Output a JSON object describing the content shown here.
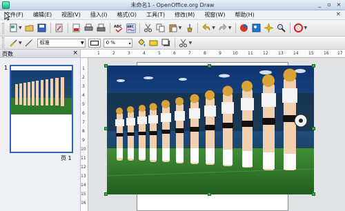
{
  "window": {
    "title": "未命名1 - OpenOffice.org Draw",
    "buttons": [
      "_",
      "▫",
      "×"
    ]
  },
  "menu": {
    "items": [
      "文件(F)",
      "编辑(E)",
      "视图(V)",
      "插入(I)",
      "格式(O)",
      "工具(T)",
      "修改(M)",
      "视窗(W)",
      "帮助(H)"
    ],
    "close": "×"
  },
  "toolbar2": {
    "style_value": "标准",
    "zoom_value": "0 %"
  },
  "panel": {
    "title": "页数",
    "close": "×",
    "slide_number": "1",
    "page_indicator": "页 1"
  },
  "ruler": {
    "top_numbers": [
      "1",
      "2",
      "3",
      "4",
      "5",
      "6",
      "7",
      "8",
      "9",
      "10",
      "11",
      "12",
      "13",
      "14",
      "15",
      "16",
      "17"
    ],
    "left_numbers": [
      "1",
      "2",
      "3",
      "4",
      "5",
      "6",
      "7",
      "8",
      "9",
      "10",
      "11",
      "12",
      "13",
      "14",
      "15",
      "16",
      "17"
    ]
  },
  "colors": {
    "selection_handle": "#3cb04b",
    "thumbnail_border": "#2b64c0",
    "pitch": "#2f7a2a"
  },
  "icons": [
    "cursor-icon",
    "new-document-icon",
    "open-folder-icon",
    "save-icon",
    "edit-file-icon",
    "export-pdf-icon",
    "print-icon",
    "spellcheck-icon",
    "autospell-icon",
    "cut-icon",
    "copy-icon",
    "paste-icon",
    "format-paintbrush-icon",
    "undo-icon",
    "redo-icon",
    "chart-icon",
    "gallery-icon",
    "navigator-icon",
    "zoom-icon",
    "help-icon"
  ]
}
